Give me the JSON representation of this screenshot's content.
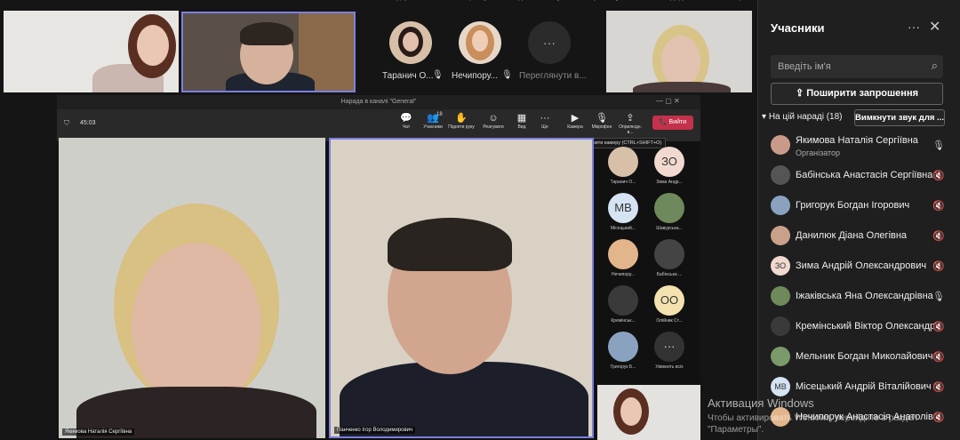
{
  "top_menu": [
    "Початок",
    "Одержані",
    "",
    "Чат",
    "Користувачі",
    "Надати",
    "Реагувати",
    "Переглянути",
    "Кімнати",
    "Додатково",
    "",
    "Камера",
    "Мікрофон",
    "Поділитися"
  ],
  "stage": {
    "avatars": [
      {
        "name": "Таранич О...",
        "mic": "muted"
      },
      {
        "name": "Нечипору...",
        "mic": "muted"
      },
      {
        "name": "Переглянути в...",
        "icon": "more-icon"
      }
    ]
  },
  "share_window": {
    "title": "Нарада в каналі \"General\"",
    "timer": "45:03",
    "toolbar": [
      {
        "icon": "chat-icon",
        "label": "Чат"
      },
      {
        "icon": "people-icon",
        "label": "Учасники",
        "count": "18"
      },
      {
        "icon": "raise-hand-icon",
        "label": "Підняти руку"
      },
      {
        "icon": "react-icon",
        "label": "Реагувати"
      },
      {
        "icon": "view-icon",
        "label": "Вид"
      },
      {
        "icon": "more-icon",
        "label": "Ще"
      },
      {
        "icon": "camera-icon",
        "label": "Камера"
      },
      {
        "icon": "mic-icon",
        "label": "Мікрофон"
      },
      {
        "icon": "share-icon",
        "label": "Оприлюдн. в..."
      }
    ],
    "leave_label": "Вийти",
    "tooltip": "Відключити камеру (CTRL+SHIFT+O)",
    "video_left_name": "Якимова Наталія Сергіївна",
    "video_right_name": "Панченко Ігор Володимирович",
    "gallery": [
      {
        "label": "Таранич О...",
        "initials": "",
        "color": "#d8c0a8"
      },
      {
        "label": "Зима Андр...",
        "initials": "ЗО",
        "color": "#f1d9cf"
      },
      {
        "label": "Місецький...",
        "initials": "МВ",
        "color": "#d5e3f3"
      },
      {
        "label": "Шавурська...",
        "initials": "",
        "color": "#6e8a5c"
      },
      {
        "label": "Нечипору...",
        "initials": "",
        "color": "#e2b58a"
      },
      {
        "label": "Бабінська ...",
        "initials": "",
        "color": "#444"
      },
      {
        "label": "Кремінськ...",
        "initials": "",
        "color": "#3a3a3a"
      },
      {
        "label": "Олійник Ст...",
        "initials": "ОО",
        "color": "#f3e2b0"
      },
      {
        "label": "Григорук Б...",
        "initials": "",
        "color": "#8aa2c0"
      },
      {
        "label": "Увімкніть всіх",
        "initials": "···",
        "color": "#333"
      }
    ]
  },
  "panel": {
    "title": "Учасники",
    "search_placeholder": "Введіть ім'я",
    "share_invite": "Поширити запрошення",
    "section": "На цій нараді (18)",
    "mute_all": "Вимкнути звук для ...",
    "participants": [
      {
        "name": "Якимова Наталія Сергіївна",
        "role": "Організатор",
        "initials": "",
        "color": "#c99a8a",
        "mic": "on"
      },
      {
        "name": "Бабінська Анастасія Сергіївна",
        "initials": "",
        "color": "#555",
        "mic": "muted"
      },
      {
        "name": "Григорук Богдан Ігорович",
        "initials": "",
        "color": "#8aa2c0",
        "mic": "muted"
      },
      {
        "name": "Данилюк Діана Олегівна",
        "initials": "",
        "color": "#c9a08a",
        "mic": "muted"
      },
      {
        "name": "Зима Андрій Олександрович",
        "initials": "ЗО",
        "color": "#f1d9cf",
        "mic": "muted"
      },
      {
        "name": "Іжаківська Яна Олександрівна",
        "initials": "",
        "color": "#6e8a5c",
        "mic": "on"
      },
      {
        "name": "Кремінський Віктор Олександр...",
        "initials": "",
        "color": "#3a3a3a",
        "mic": "muted"
      },
      {
        "name": "Мельник Богдан Миколайович",
        "initials": "",
        "color": "#7a9a6a",
        "mic": "muted"
      },
      {
        "name": "Місецький Андрій Віталійович",
        "initials": "МВ",
        "color": "#d5e3f3",
        "mic": "muted"
      },
      {
        "name": "Нечипорук Анастасія Анатолів...",
        "initials": "",
        "color": "#e2b58a",
        "mic": "muted"
      }
    ]
  },
  "watermark": {
    "line1": "Активация Windows",
    "line2": "Чтобы активировать Windows, перейдите в раздел",
    "line3": "\"Параметры\"."
  }
}
